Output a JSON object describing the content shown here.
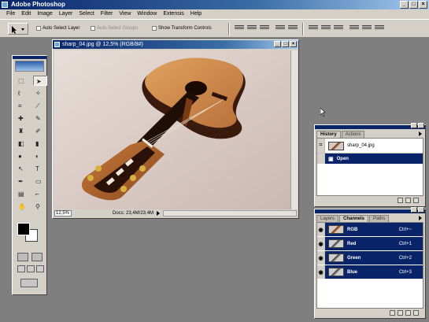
{
  "app": {
    "title": "Adobe Photoshop"
  },
  "menu": [
    "File",
    "Edit",
    "Image",
    "Layer",
    "Select",
    "Filter",
    "View",
    "Window",
    "Extensis",
    "Help"
  ],
  "options": {
    "auto_select_layer": "Auto Select Layer",
    "auto_select_groups": "Auto Select Groups",
    "show_transform_controls": "Show Transform Controls"
  },
  "document": {
    "title": "sharp_04.jpg @ 12,5% (RGB/8#)",
    "zoom": "12,5%",
    "doc_info": "Docs: 23,4M/23,4M"
  },
  "history_panel": {
    "tabs": [
      "History",
      "Actions"
    ],
    "snapshot": "sharp_04.jpg",
    "states": [
      "Open"
    ]
  },
  "channels_panel": {
    "tabs": [
      "Layers",
      "Channels",
      "Paths"
    ],
    "channels": [
      {
        "name": "RGB",
        "shortcut": "Ctrl+~"
      },
      {
        "name": "Red",
        "shortcut": "Ctrl+1"
      },
      {
        "name": "Green",
        "shortcut": "Ctrl+2"
      },
      {
        "name": "Blue",
        "shortcut": "Ctrl+3"
      }
    ]
  },
  "colors": {
    "selection": "#0a246a",
    "foreground": "#000000",
    "background": "#ffffff",
    "workspace": "#7f7f7f"
  },
  "icons": {
    "window_controls": [
      "minimize-icon",
      "maximize-icon",
      "close-icon"
    ],
    "tools": [
      "marquee",
      "move",
      "lasso",
      "magic-wand",
      "crop",
      "slice",
      "healing-brush",
      "brush",
      "clone-stamp",
      "history-brush",
      "eraser",
      "gradient",
      "blur",
      "dodge",
      "path-selection",
      "type",
      "pen",
      "shape",
      "notes",
      "eyedropper",
      "hand",
      "zoom"
    ]
  }
}
